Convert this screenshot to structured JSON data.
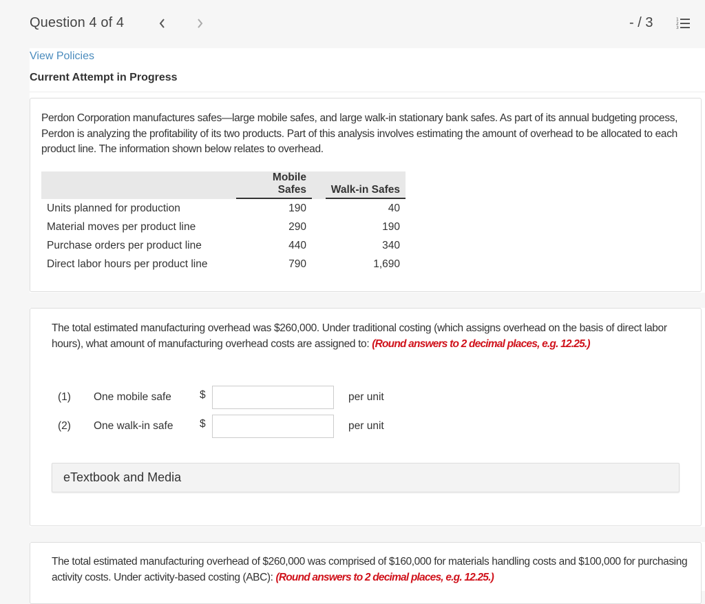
{
  "header": {
    "question_label": "Question 4 of 4",
    "prev_icon": "chevron-left-icon",
    "next_icon": "chevron-right-icon",
    "score": "- / 3",
    "list_icon": "numbered-list-icon"
  },
  "links": {
    "view_policies": "View Policies"
  },
  "status": {
    "attempt": "Current Attempt in Progress"
  },
  "problem": {
    "intro": "Perdon Corporation manufactures safes—large mobile safes, and large walk-in stationary bank safes. As part of its annual budgeting process, Perdon is analyzing the profitability of its two products. Part of this analysis involves estimating the amount of overhead to be allocated to each product line. The information shown below relates to overhead.",
    "table": {
      "columns": [
        "",
        "Mobile Safes",
        "Walk-in Safes"
      ],
      "rows": [
        {
          "label": "Units planned for production",
          "mobile": "190",
          "walkin": "40"
        },
        {
          "label": "Material moves per product line",
          "mobile": "290",
          "walkin": "190"
        },
        {
          "label": "Purchase orders per product line",
          "mobile": "440",
          "walkin": "340"
        },
        {
          "label": "Direct labor hours per product line",
          "mobile": "790",
          "walkin": "1,690"
        }
      ]
    }
  },
  "part1": {
    "text": "The total estimated manufacturing overhead was $260,000. Under traditional costing (which assigns overhead on the basis of direct labor hours), what amount of manufacturing overhead costs are assigned to: ",
    "note": "(Round answers to 2 decimal places, e.g. 12.25.)",
    "answers": [
      {
        "number": "(1)",
        "label": "One mobile safe",
        "currency": "$",
        "value": "",
        "placeholder": "",
        "unit": "per unit"
      },
      {
        "number": "(2)",
        "label": "One walk-in safe",
        "currency": "$",
        "value": "",
        "placeholder": "",
        "unit": "per unit"
      }
    ],
    "etextbook": "eTextbook and Media"
  },
  "part2": {
    "text": "The total estimated manufacturing overhead of $260,000 was comprised of $160,000 for materials handling costs and $100,000 for purchasing activity costs. Under activity-based costing (ABC): ",
    "note": "(Round answers to 2 decimal places, e.g. 12.25.)"
  },
  "colors": {
    "link": "#4a8bbd",
    "note_red": "#d0121b",
    "page_bg": "#f6f6f6",
    "table_header_bg": "#e8e8e8"
  }
}
